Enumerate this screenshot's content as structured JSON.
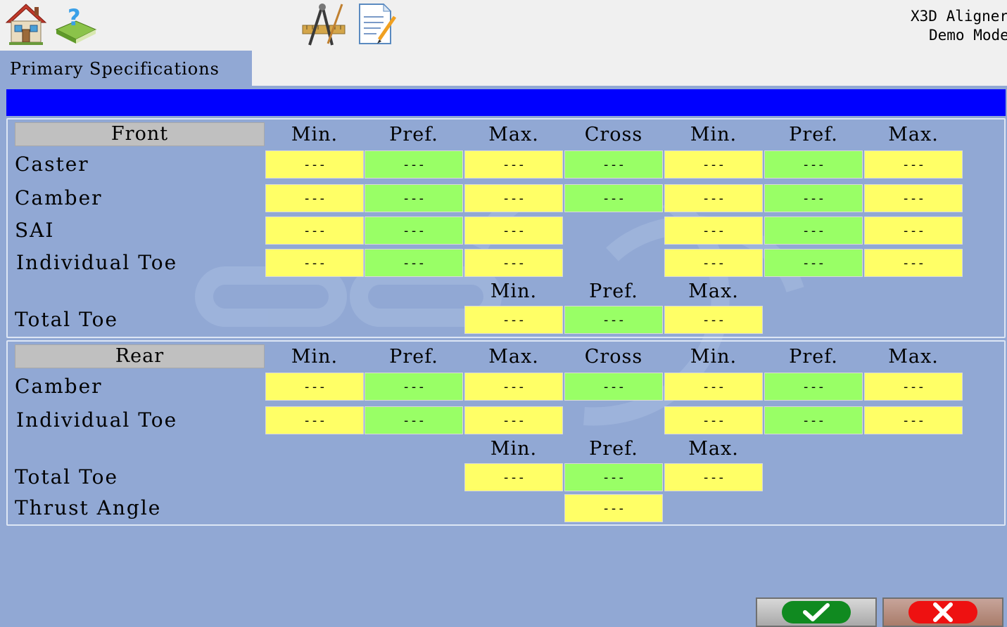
{
  "app": {
    "title": "X3D Aligner",
    "mode": "Demo Mode"
  },
  "toolbar": {
    "icons": [
      "home-icon",
      "help-book-icon",
      "drawing-tools-icon",
      "notepad-edit-icon"
    ]
  },
  "tab": {
    "label": "Primary Specifications"
  },
  "columns": [
    "Min.",
    "Pref.",
    "Max.",
    "Cross",
    "Min.",
    "Pref.",
    "Max."
  ],
  "total_columns": [
    "Min.",
    "Pref.",
    "Max."
  ],
  "empty_value": "---",
  "colors": {
    "min_max": "#ffff66",
    "preferred": "#99ff66",
    "background": "#91a8d4",
    "header_bar": "#0000ff"
  },
  "front": {
    "header": "Front",
    "rows": [
      {
        "label": "Caster",
        "values": [
          "---",
          "---",
          "---",
          "---",
          "---",
          "---",
          "---"
        ]
      },
      {
        "label": "Camber",
        "values": [
          "---",
          "---",
          "---",
          "---",
          "---",
          "---",
          "---"
        ]
      },
      {
        "label": "SAI",
        "values": [
          "---",
          "---",
          "---",
          "",
          "---",
          "---",
          "---"
        ]
      },
      {
        "label": "Individual Toe",
        "values": [
          "---",
          "---",
          "---",
          "",
          "---",
          "---",
          "---"
        ]
      }
    ],
    "total_toe": {
      "label": "Total Toe",
      "values": [
        "---",
        "---",
        "---"
      ]
    }
  },
  "rear": {
    "header": "Rear",
    "rows": [
      {
        "label": "Camber",
        "values": [
          "---",
          "---",
          "---",
          "---",
          "---",
          "---",
          "---"
        ]
      },
      {
        "label": "Individual Toe",
        "values": [
          "---",
          "---",
          "---",
          "",
          "---",
          "---",
          "---"
        ]
      }
    ],
    "total_toe": {
      "label": "Total Toe",
      "values": [
        "---",
        "---",
        "---"
      ]
    },
    "thrust_angle": {
      "label": "Thrust Angle",
      "value": "---"
    }
  },
  "buttons": {
    "ok": "checkmark-icon",
    "cancel": "x-icon"
  }
}
